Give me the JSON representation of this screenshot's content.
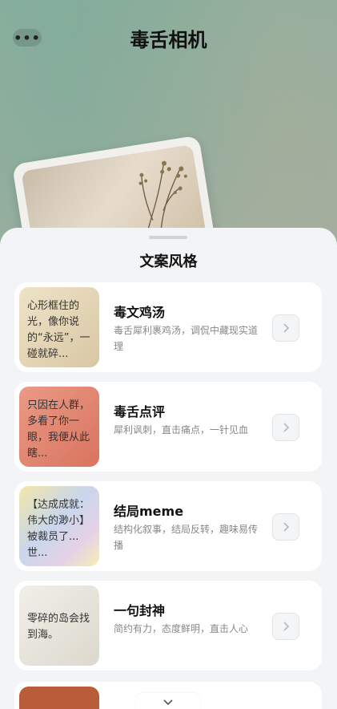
{
  "header": {
    "more_label": "•••",
    "title": "毒舌相机"
  },
  "sheet": {
    "title": "文案风格",
    "styles": [
      {
        "name": "毒文鸡汤",
        "description": "毒舌犀利裹鸡汤，调侃中藏现实道理",
        "thumbnail_text": "心形框住的光，像你说的“永远”，一碰就碎...",
        "thumbnail_color": "#e6d8bd"
      },
      {
        "name": "毒舌点评",
        "description": "犀利讽刺，直击痛点，一针见血",
        "thumbnail_text": "只因在人群，多看了你一眼，我便从此瞎...",
        "thumbnail_color": "#e58a78"
      },
      {
        "name": "结局meme",
        "description": "结构化叙事，结局反转，趣味易传播",
        "thumbnail_text": "【达成成就：伟大的渺小】被裁员了... 世...",
        "thumbnail_color": "#d9d2e8"
      },
      {
        "name": "一句封神",
        "description": "简约有力，态度鲜明，直击人心",
        "thumbnail_text": "零碎的岛会找到海。",
        "thumbnail_color": "#ebe8e0"
      }
    ]
  },
  "colors": {
    "accent_text": "#111111",
    "muted_text": "#888888",
    "sheet_bg": "#f3f4f6"
  }
}
